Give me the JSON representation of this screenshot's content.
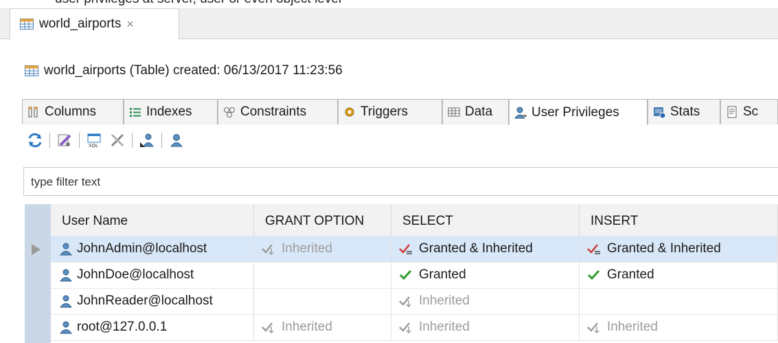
{
  "caption": "user privileges at server, user or even object level",
  "editor": {
    "tab_title": "world_airports",
    "tab_close": "×"
  },
  "header": {
    "info": "world_airports (Table) created: 06/13/2017 11:23:56"
  },
  "subtabs": [
    "Columns",
    "Indexes",
    "Constraints",
    "Triggers",
    "Data",
    "User Privileges",
    "Stats",
    "Sc"
  ],
  "filter": {
    "placeholder": "type filter text"
  },
  "grid": {
    "columns": [
      "User Name",
      "GRANT OPTION",
      "SELECT",
      "INSERT"
    ],
    "rows": [
      {
        "user": "JohnAdmin@localhost",
        "grant_option": "Inherited",
        "select": "Granted & Inherited",
        "insert": "Granted & Inherited"
      },
      {
        "user": "JohnDoe@localhost",
        "grant_option": "",
        "select": "Granted",
        "insert": "Granted"
      },
      {
        "user": "JohnReader@localhost",
        "grant_option": "",
        "select": "Inherited",
        "insert": ""
      },
      {
        "user": "root@127.0.0.1",
        "grant_option": "Inherited",
        "select": "Inherited",
        "insert": "Inherited"
      }
    ]
  },
  "colors": {
    "selection": "#d9e8f8",
    "row_header": "#c9d7e6",
    "granted": "#2e9b2e",
    "granted_inherited": "#d23b3b",
    "inherited": "#9c9c9c"
  }
}
